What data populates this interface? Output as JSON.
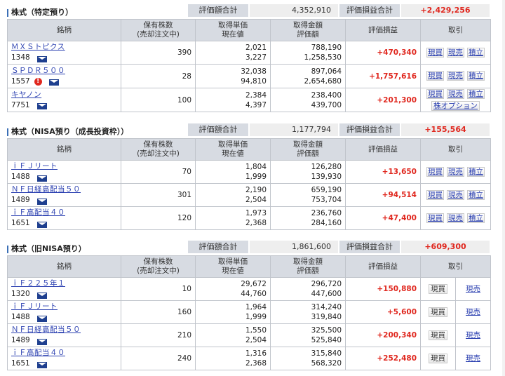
{
  "columns": {
    "name": "銘柄",
    "qty_line1": "保有株数",
    "qty_line2": "(売却注文中)",
    "cost_line1": "取得単価",
    "cost_line2": "現在値",
    "amount_line1": "取得金額",
    "amount_line2": "評価額",
    "pl": "評価損益",
    "trade": "取引"
  },
  "summary_labels": {
    "valuation_total": "評価額合計",
    "pl_total": "評価損益合計"
  },
  "actions": {
    "buy": "現買",
    "sell": "現売",
    "accumulate": "積立",
    "option": "株オプション"
  },
  "sections": [
    {
      "title": "株式（特定預り）",
      "valuation_total": "4,352,910",
      "pl_total": "+2,429,256",
      "rows": [
        {
          "name": "ＭＸＳトピクス",
          "code": "1348",
          "qty": "390",
          "cost": "2,021",
          "price": "3,227",
          "amount": "788,190",
          "value": "1,258,530",
          "pl": "+470,340"
        },
        {
          "name": "ＳＰＤＲ５００",
          "code": "1557",
          "qty": "28",
          "cost": "32,038",
          "price": "94,810",
          "amount": "897,064",
          "value": "2,654,680",
          "pl": "+1,757,616",
          "alert": "!"
        },
        {
          "name": "キヤノン",
          "code": "7751",
          "qty": "100",
          "cost": "2,384",
          "price": "4,397",
          "amount": "238,400",
          "value": "439,700",
          "pl": "+201,300"
        }
      ]
    },
    {
      "title": "株式（NISA預り（成長投資枠））",
      "valuation_total": "1,177,794",
      "pl_total": "+155,564",
      "rows": [
        {
          "name": "ｉＦＪリート",
          "code": "1488",
          "qty": "70",
          "cost": "1,804",
          "price": "1,999",
          "amount": "126,280",
          "value": "139,930",
          "pl": "+13,650"
        },
        {
          "name": "ＮＦ日経高配当５０",
          "code": "1489",
          "qty": "301",
          "cost": "2,190",
          "price": "2,504",
          "amount": "659,190",
          "value": "753,704",
          "pl": "+94,514"
        },
        {
          "name": "ｉＦ高配当４０",
          "code": "1651",
          "qty": "120",
          "cost": "1,973",
          "price": "2,368",
          "amount": "236,760",
          "value": "284,160",
          "pl": "+47,400"
        }
      ]
    },
    {
      "title": "株式（旧NISA預り）",
      "valuation_total": "1,861,600",
      "pl_total": "+609,300",
      "rows": [
        {
          "name": "ｉＦ２２５年１",
          "code": "1320",
          "qty": "10",
          "cost": "29,672",
          "price": "44,760",
          "amount": "296,720",
          "value": "447,600",
          "pl": "+150,880"
        },
        {
          "name": "ｉＦＪリート",
          "code": "1488",
          "qty": "160",
          "cost": "1,964",
          "price": "1,999",
          "amount": "314,240",
          "value": "319,840",
          "pl": "+5,600"
        },
        {
          "name": "ＮＦ日経高配当５０",
          "code": "1489",
          "qty": "210",
          "cost": "1,550",
          "price": "2,504",
          "amount": "325,500",
          "value": "525,840",
          "pl": "+200,340"
        },
        {
          "name": "ｉＦ高配当４０",
          "code": "1651",
          "qty": "240",
          "cost": "1,316",
          "price": "2,368",
          "amount": "315,840",
          "value": "568,320",
          "pl": "+252,480"
        }
      ]
    }
  ]
}
